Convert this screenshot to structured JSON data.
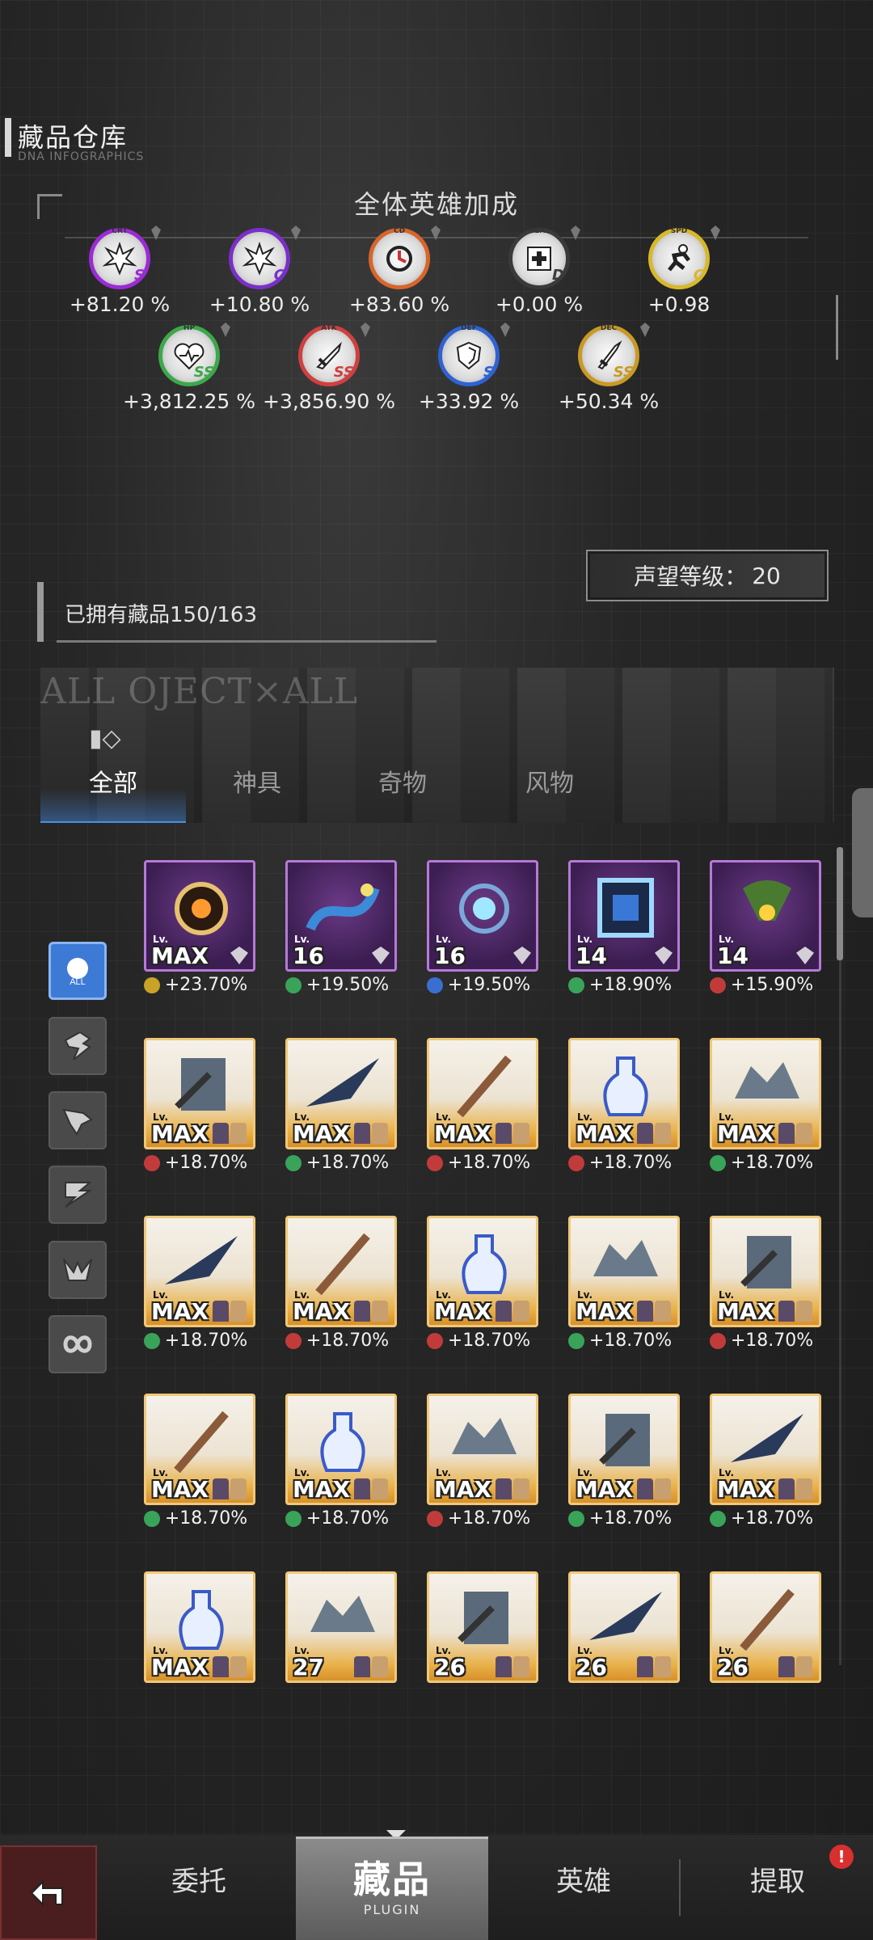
{
  "header": {
    "title": "藏品仓库",
    "subtitle": "DNA INFOGRAPHICS"
  },
  "bonus_panel": {
    "heading": "全体英雄加成",
    "stats": [
      {
        "tag": "CRT",
        "grade": "S",
        "value": "+81.20 %",
        "color": "#9b2bd6",
        "icon": "crit-burst-icon"
      },
      {
        "tag": "",
        "grade": "C",
        "value": "+10.80 %",
        "color": "#7a2fc9",
        "icon": "burst-icon"
      },
      {
        "tag": "CD",
        "grade": "",
        "value": "+83.60 %",
        "color": "#d9652b",
        "icon": "cooldown-icon"
      },
      {
        "tag": "HEAL",
        "grade": "D",
        "value": "+0.00 %",
        "color": "#3a3a3a",
        "icon": "heal-cross-icon"
      },
      {
        "tag": "SPD",
        "grade": "C",
        "value": "+0.98",
        "color": "#d8b82a",
        "icon": "speed-runner-icon"
      },
      {
        "tag": "HP",
        "grade": "SS",
        "value": "+3,812.25 %",
        "color": "#3ca84a",
        "icon": "heart-icon"
      },
      {
        "tag": "ATK",
        "grade": "SS",
        "value": "+3,856.90 %",
        "color": "#d04040",
        "icon": "sword-icon"
      },
      {
        "tag": "DEF",
        "grade": "S",
        "value": "+33.92 %",
        "color": "#2f62d4",
        "icon": "shield-icon"
      },
      {
        "tag": "DEC",
        "grade": "SS",
        "value": "+50.34 %",
        "color": "#c99a22",
        "icon": "dagger-icon"
      }
    ]
  },
  "prestige": {
    "label": "声望等级：",
    "value": "20"
  },
  "owned": {
    "text": "已拥有藏品150/163"
  },
  "banner": {
    "background_text": "ALL OJECT×ALL",
    "tabs": [
      "全部",
      "神具",
      "奇物",
      "风物"
    ],
    "active_tab": "全部"
  },
  "filters": [
    {
      "name": "filter-all",
      "label": "ALL",
      "active": true
    },
    {
      "name": "filter-type-1",
      "label": "",
      "active": false
    },
    {
      "name": "filter-type-2",
      "label": "",
      "active": false
    },
    {
      "name": "filter-type-3",
      "label": "",
      "active": false
    },
    {
      "name": "filter-type-4",
      "label": "",
      "active": false
    },
    {
      "name": "filter-type-5",
      "label": "",
      "active": false
    }
  ],
  "items": [
    {
      "rarity": "purple",
      "level": "MAX",
      "bonus": "+23.70%",
      "stat": "crit",
      "lv_label": "Lv."
    },
    {
      "rarity": "purple",
      "level": "16",
      "bonus": "+19.50%",
      "stat": "heal",
      "lv_label": "Lv."
    },
    {
      "rarity": "purple",
      "level": "16",
      "bonus": "+19.50%",
      "stat": "def",
      "lv_label": "Lv."
    },
    {
      "rarity": "purple",
      "level": "14",
      "bonus": "+18.90%",
      "stat": "heal",
      "lv_label": "Lv."
    },
    {
      "rarity": "purple",
      "level": "14",
      "bonus": "+15.90%",
      "stat": "atk",
      "lv_label": "Lv."
    },
    {
      "rarity": "gold",
      "level": "MAX",
      "bonus": "+18.70%",
      "stat": "atk",
      "lv_label": "Lv."
    },
    {
      "rarity": "gold",
      "level": "MAX",
      "bonus": "+18.70%",
      "stat": "heal",
      "lv_label": "Lv."
    },
    {
      "rarity": "gold",
      "level": "MAX",
      "bonus": "+18.70%",
      "stat": "atk",
      "lv_label": "Lv."
    },
    {
      "rarity": "gold",
      "level": "MAX",
      "bonus": "+18.70%",
      "stat": "atk",
      "lv_label": "Lv."
    },
    {
      "rarity": "gold",
      "level": "MAX",
      "bonus": "+18.70%",
      "stat": "heal",
      "lv_label": "Lv."
    },
    {
      "rarity": "gold",
      "level": "MAX",
      "bonus": "+18.70%",
      "stat": "heal",
      "lv_label": "Lv."
    },
    {
      "rarity": "gold",
      "level": "MAX",
      "bonus": "+18.70%",
      "stat": "atk",
      "lv_label": "Lv."
    },
    {
      "rarity": "gold",
      "level": "MAX",
      "bonus": "+18.70%",
      "stat": "atk",
      "lv_label": "Lv."
    },
    {
      "rarity": "gold",
      "level": "MAX",
      "bonus": "+18.70%",
      "stat": "heal",
      "lv_label": "Lv."
    },
    {
      "rarity": "gold",
      "level": "MAX",
      "bonus": "+18.70%",
      "stat": "atk",
      "lv_label": "Lv."
    },
    {
      "rarity": "gold",
      "level": "MAX",
      "bonus": "+18.70%",
      "stat": "heal",
      "lv_label": "Lv."
    },
    {
      "rarity": "gold",
      "level": "MAX",
      "bonus": "+18.70%",
      "stat": "heal",
      "lv_label": "Lv."
    },
    {
      "rarity": "gold",
      "level": "MAX",
      "bonus": "+18.70%",
      "stat": "atk",
      "lv_label": "Lv."
    },
    {
      "rarity": "gold",
      "level": "MAX",
      "bonus": "+18.70%",
      "stat": "heal",
      "lv_label": "Lv."
    },
    {
      "rarity": "gold",
      "level": "MAX",
      "bonus": "+18.70%",
      "stat": "heal",
      "lv_label": "Lv."
    },
    {
      "rarity": "gold",
      "level": "MAX",
      "bonus": "",
      "stat": "",
      "lv_label": "Lv."
    },
    {
      "rarity": "gold",
      "level": "27",
      "bonus": "",
      "stat": "",
      "lv_label": "Lv."
    },
    {
      "rarity": "gold",
      "level": "26",
      "bonus": "",
      "stat": "",
      "lv_label": "Lv."
    },
    {
      "rarity": "gold",
      "level": "26",
      "bonus": "",
      "stat": "",
      "lv_label": "Lv."
    },
    {
      "rarity": "gold",
      "level": "26",
      "bonus": "",
      "stat": "",
      "lv_label": "Lv."
    }
  ],
  "nav": {
    "back_icon": "back-arrow-icon",
    "items": [
      "委托",
      "英雄",
      "提取"
    ],
    "active_label": "藏品",
    "active_sub": "PLUGIN",
    "badge": "!"
  },
  "colors": {
    "accent_blue": "#4a8fe0",
    "alert_red": "#d8302f"
  }
}
